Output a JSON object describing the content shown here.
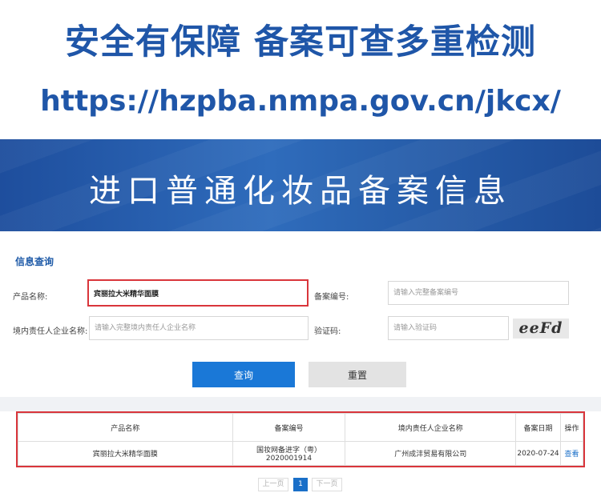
{
  "promo": {
    "headline": "安全有保障 备案可查多重检测",
    "url": "https://hzpba.nmpa.gov.cn/jkcx/",
    "banner_title": "进口普通化妆品备案信息"
  },
  "query_form": {
    "title": "信息查询",
    "product_name_label": "产品名称:",
    "product_name_value": "宾丽拉大米精华面膜",
    "record_no_label": "备案编号:",
    "record_no_placeholder": "请输入完整备案编号",
    "company_label": "境内责任人企业名称:",
    "company_placeholder": "请输入完整境内责任人企业名称",
    "captcha_label": "验证码:",
    "captcha_placeholder": "请输入验证码",
    "captcha_text": "eeFd",
    "search_button": "查询",
    "reset_button": "重置"
  },
  "results": {
    "columns": [
      "产品名称",
      "备案编号",
      "境内责任人企业名称",
      "备案日期",
      "操作"
    ],
    "rows": [
      {
        "product_name": "宾丽拉大米精华面膜",
        "record_no": "国妆网备进字（粤）2020001914",
        "company": "广州成沣贸易有限公司",
        "date": "2020-07-24",
        "action": "查看"
      }
    ]
  },
  "pagination": {
    "prev": "上一页",
    "current": "1",
    "next": "下一页"
  },
  "colors": {
    "brand_blue": "#1f56a8",
    "button_blue": "#1a78d7",
    "highlight_red": "#d9353b"
  }
}
